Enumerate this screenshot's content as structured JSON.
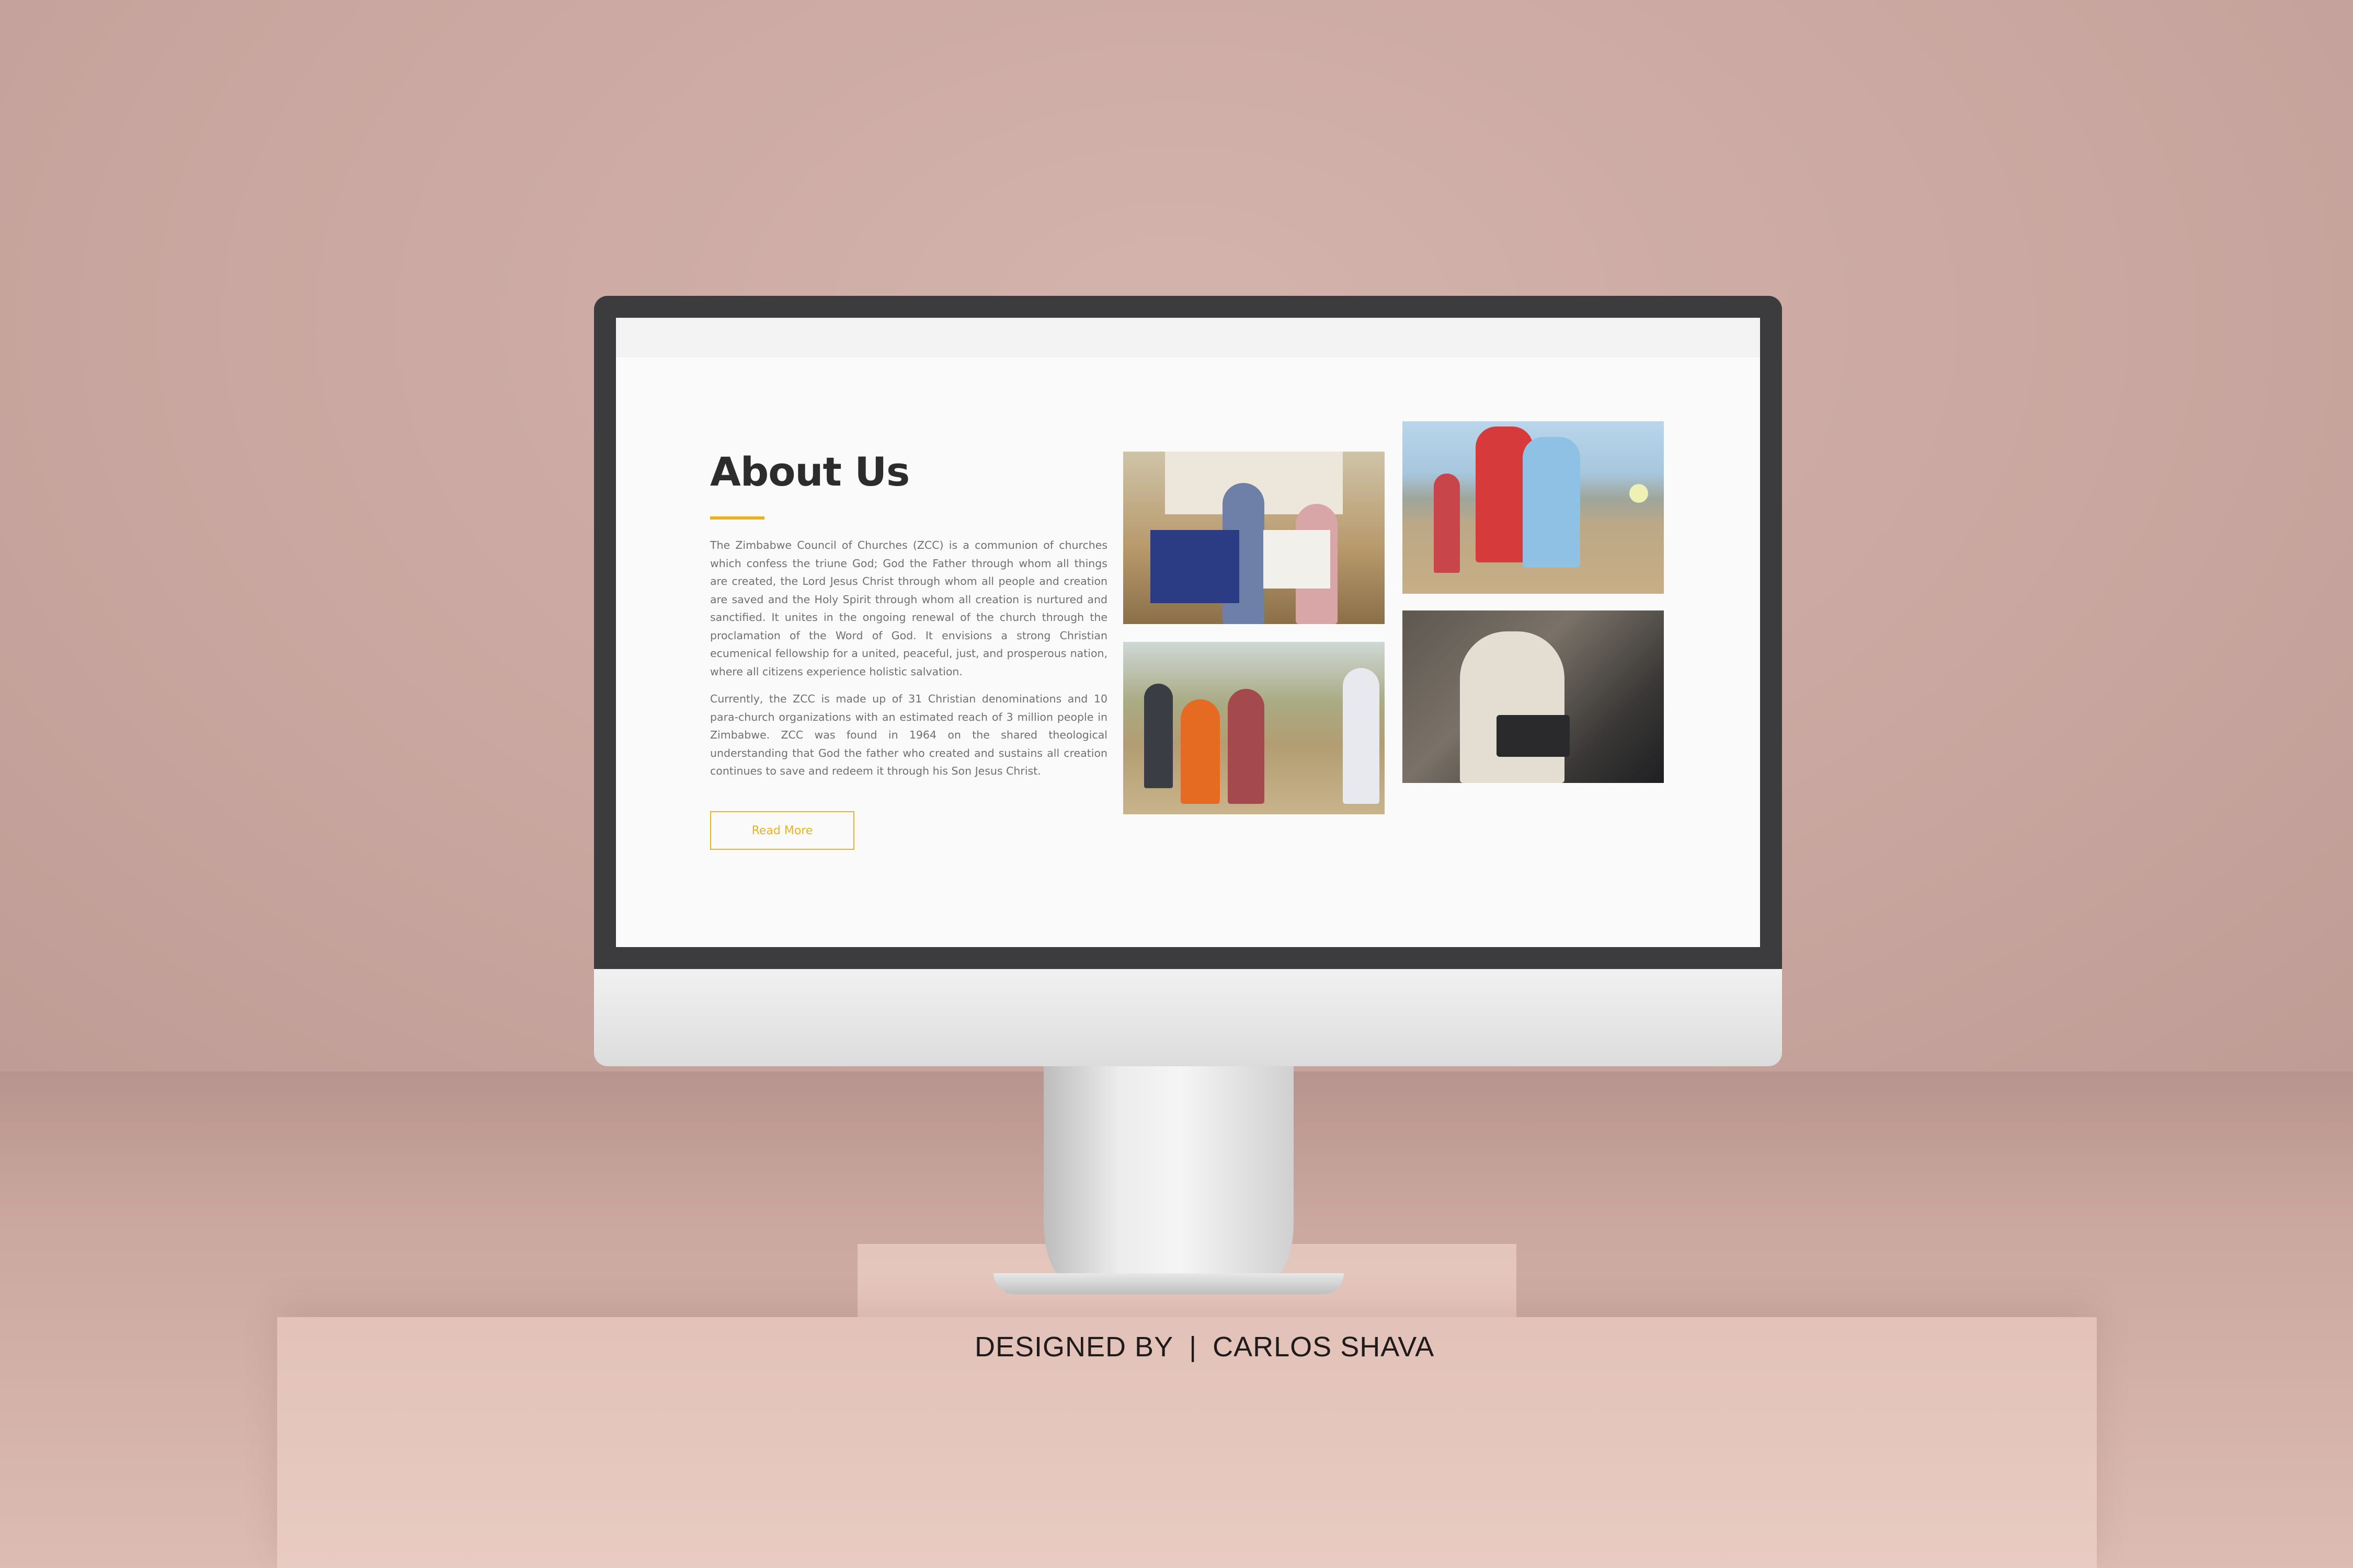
{
  "page": {
    "section_title": "About Us",
    "paragraphs": [
      "The Zimbabwe Council of Churches (ZCC) is a communion of churches which confess the triune God; God the Father through whom all things are created, the Lord Jesus Christ through whom all people and creation are saved and the Holy Spirit through whom all creation is nurtured and sanctified. It unites in the ongoing renewal of the church through the proclamation of the Word of God. It envisions a strong Christian ecumenical fellowship for a united, peaceful, just, and prosperous nation, where all citizens experience holistic salvation.",
      "Currently, the ZCC is made up of 31 Christian denominations and 10 para-church organizations with an estimated reach of 3 million people in Zimbabwe. ZCC was found in 1964 on the shared theological understanding that God the father who created and sustains all creation continues to save and redeem it through his Son Jesus Christ."
    ],
    "read_more_label": "Read More",
    "accent_color": "#e6b325",
    "photos": [
      {
        "name": "zcc-banner-photo"
      },
      {
        "name": "football-match-photo"
      },
      {
        "name": "field-visit-photo"
      },
      {
        "name": "speaker-podium-photo"
      }
    ]
  },
  "credit": {
    "designed_by": "DESIGNED BY",
    "separator": "|",
    "designer": "CARLOS SHAVA"
  }
}
